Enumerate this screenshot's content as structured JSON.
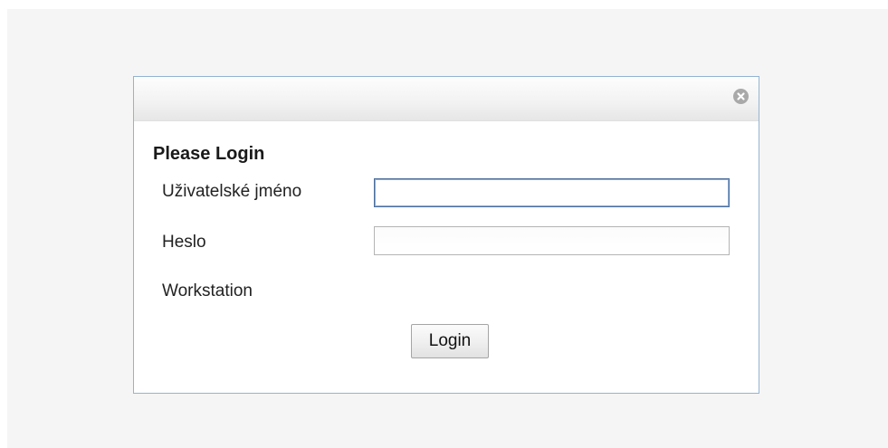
{
  "dialog": {
    "title": "Please Login",
    "close_icon": "close-circle-icon"
  },
  "form": {
    "username_label": "Uživatelské jméno",
    "username_value": "",
    "password_label": "Heslo",
    "password_value": "",
    "workstation_label": "Workstation",
    "login_label": "Login"
  },
  "colors": {
    "dialog_border": "#94b4d0",
    "focused_input_border": "#4d6f9b",
    "page_background": "#f5f5f5"
  }
}
